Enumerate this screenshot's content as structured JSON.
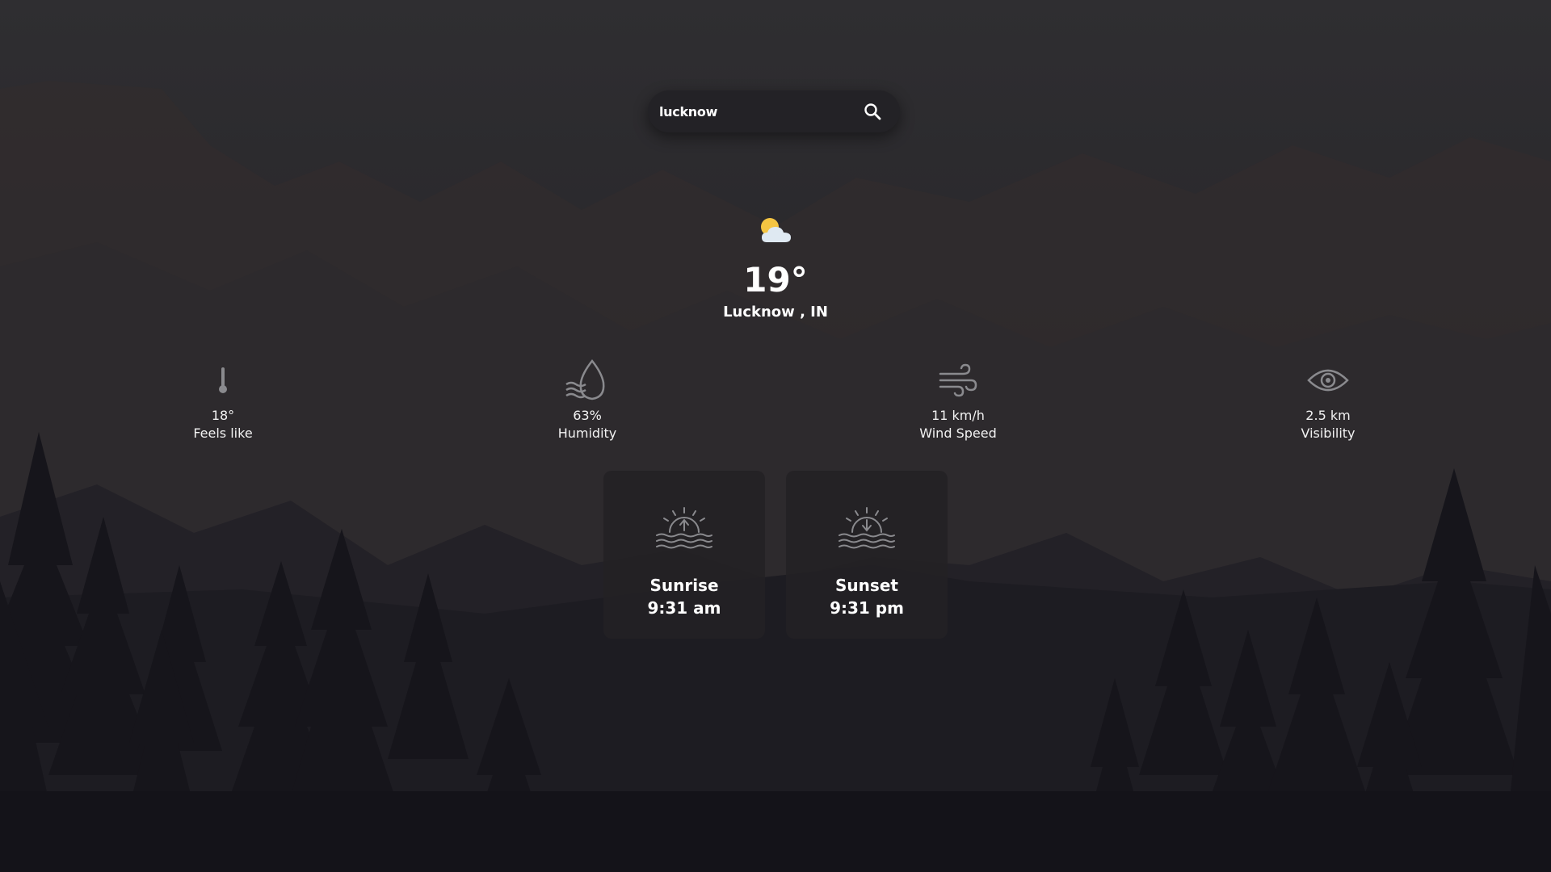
{
  "search": {
    "value": "lucknow",
    "icon": "search-icon"
  },
  "current": {
    "icon": "partly-cloudy-icon",
    "temperature": "19°",
    "location": "Lucknow , IN"
  },
  "stats": {
    "feels_like": {
      "icon": "thermometer-icon",
      "value": "18°",
      "label": "Feels like"
    },
    "humidity": {
      "icon": "water-drop-icon",
      "value": "63%",
      "label": "Humidity"
    },
    "wind": {
      "icon": "wind-icon",
      "value": "11 km/h",
      "label": "Wind Speed"
    },
    "visibility": {
      "icon": "eye-icon",
      "value": "2.5 km",
      "label": "Visibility"
    }
  },
  "sun": {
    "sunrise": {
      "icon": "sunrise-icon",
      "label": "Sunrise",
      "time": "9:31 am"
    },
    "sunset": {
      "icon": "sunset-icon",
      "label": "Sunset",
      "time": "9:31 pm"
    }
  },
  "colors": {
    "background": "#2b2a2d",
    "sun": "#f5c542",
    "cloud": "#dfe9f2",
    "icon_stroke": "#8a8a8e"
  }
}
